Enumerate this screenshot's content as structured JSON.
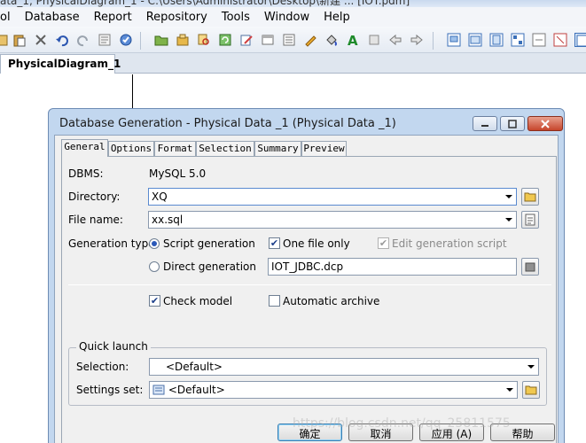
{
  "app": {
    "title_fragment": "ata_1, PhysicalDiagram_1 - C:\\Users\\Administrator\\Desktop\\新建 ... [IOT.pdm]",
    "menu": [
      "ol",
      "Database",
      "Report",
      "Repository",
      "Tools",
      "Window",
      "Help"
    ],
    "document_tab": "PhysicalDiagram_1"
  },
  "toolbar_icons": [
    "paste-icon",
    "delete-icon",
    "undo-icon",
    "redo-icon",
    "properties-icon",
    "check-model-icon",
    "open-folder-icon",
    "package-icon",
    "find-icon",
    "refresh-icon",
    "edit-icon",
    "window-icon",
    "list-icon",
    "pen-icon",
    "fill-icon",
    "text-icon",
    "move-icon",
    "back-icon",
    "forward-icon",
    "diagram-icon-1",
    "diagram-icon-2",
    "diagram-icon-3",
    "diagram-icon-4",
    "diagram-icon-5",
    "diagram-icon-6",
    "diagram-icon-7"
  ],
  "dialog": {
    "title": "Database Generation - Physical Data _1 (Physical Data _1)",
    "tabs": [
      "General",
      "Options",
      "Format",
      "Selection",
      "Summary",
      "Preview"
    ],
    "active_tab": "General",
    "dbms_label": "DBMS:",
    "dbms_value": "MySQL 5.0",
    "directory_label": "Directory:",
    "directory_value": "XQ",
    "filename_label": "File name:",
    "filename_value": "xx.sql",
    "generation_type_label": "Generation type:",
    "script_generation_label": "Script generation",
    "direct_generation_label": "Direct generation",
    "one_file_only_label": "One file only",
    "edit_generation_script_label": "Edit generation script",
    "data_source_value": "IOT_JDBC.dcp",
    "check_model_label": "Check model",
    "automatic_archive_label": "Automatic archive",
    "quick_launch_title": "Quick launch",
    "selection_label": "Selection:",
    "selection_value": "<Default>",
    "settings_set_label": "Settings set:",
    "settings_set_value": "<Default>",
    "buttons": {
      "ok": "确定",
      "cancel": "取消",
      "apply": "应用 (A)",
      "help": "帮助"
    }
  },
  "watermark": "https://blog.csdn.net/qq_25811575"
}
